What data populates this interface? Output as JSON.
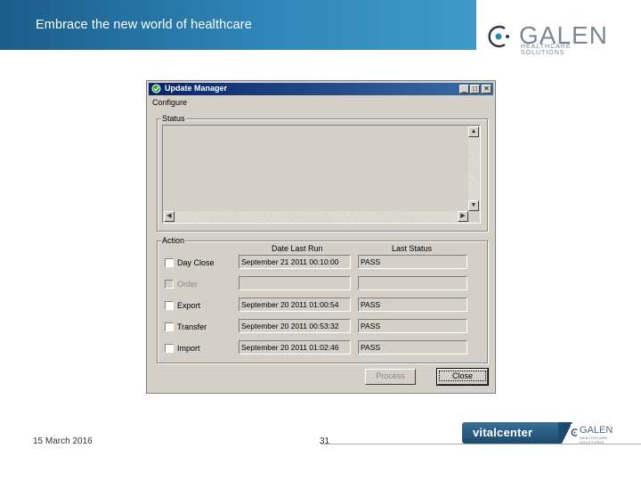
{
  "slide": {
    "banner_title": "Embrace the new world of healthcare",
    "logo_word": "GALEN",
    "logo_sub": "HEALTHCARE SOLUTIONS",
    "footer_date": "15 March 2016",
    "footer_page": "31",
    "vc_text": "vitalcenter",
    "vc_galen_word": "GALEN",
    "vc_galen_sub": "HEALTHCARE SOLUTIONS"
  },
  "window": {
    "title": "Update Manager",
    "menu": "Configure",
    "status_group": "Status",
    "action_group": "Action",
    "col_date": "Date Last Run",
    "col_status": "Last Status",
    "rows": [
      {
        "label": "Day Close",
        "date": "September 21 2011 00:10:00",
        "status": "PASS",
        "enabled": true
      },
      {
        "label": "Order",
        "date": "",
        "status": "",
        "enabled": false
      },
      {
        "label": "Export",
        "date": "September 20 2011 01:00:54",
        "status": "PASS",
        "enabled": true
      },
      {
        "label": "Transfer",
        "date": "September 20 2011 00:53:32",
        "status": "PASS",
        "enabled": true
      },
      {
        "label": "Import",
        "date": "September 20 2011 01:02:46",
        "status": "PASS",
        "enabled": true
      }
    ],
    "process_label": "Process",
    "close_label": "Close"
  }
}
